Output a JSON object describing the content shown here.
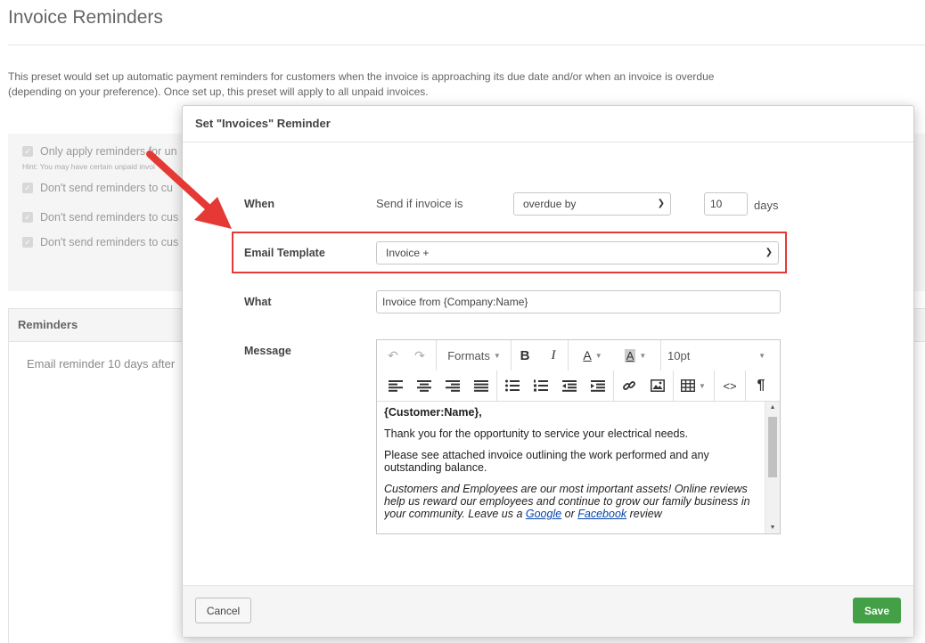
{
  "page": {
    "title": "Invoice Reminders",
    "intro": "This preset would set up automatic payment reminders for customers when the invoice is approaching its due date and/or when an invoice is overdue (depending on your preference). Once set up, this preset will apply to all unpaid invoices."
  },
  "settings": {
    "options": [
      "Only apply reminders for un",
      "Don't send reminders to cu",
      "Don't send reminders to cus",
      "Don't send reminders to cus"
    ],
    "hint": "Hint: You may have certain unpaid invoi"
  },
  "reminders": {
    "header": "Reminders",
    "line": "Email reminder 10 days after"
  },
  "modal": {
    "title": "Set \"Invoices\" Reminder",
    "when": {
      "label": "When",
      "prefix": "Send if invoice is",
      "condition": "overdue by",
      "days_value": "10",
      "days_suffix": "days"
    },
    "template": {
      "label": "Email Template",
      "value": "Invoice +"
    },
    "what": {
      "label": "What",
      "value": "Invoice from {Company:Name}"
    },
    "message": {
      "label": "Message",
      "toolbar": {
        "formats": "Formats",
        "bold": "B",
        "italic": "I",
        "font_size": "10pt"
      },
      "greeting": "{Customer:Name},",
      "p1": "Thank you for the opportunity to service your electrical needs.",
      "p2": "Please see attached invoice outlining the work performed and any outstanding balance.",
      "p3_intro": "Customers and Employees are our most important assets!  Online reviews help us reward our employees and continue to grow our family business in your community.   Leave us a ",
      "link_google": "Google",
      "p3_or": " or ",
      "link_facebook": "Facebook",
      "p3_end": " review"
    },
    "buttons": {
      "cancel": "Cancel",
      "save": "Save"
    }
  },
  "colors": {
    "save": "#43a047",
    "highlight": "#e53935",
    "link": "#0645ad"
  }
}
